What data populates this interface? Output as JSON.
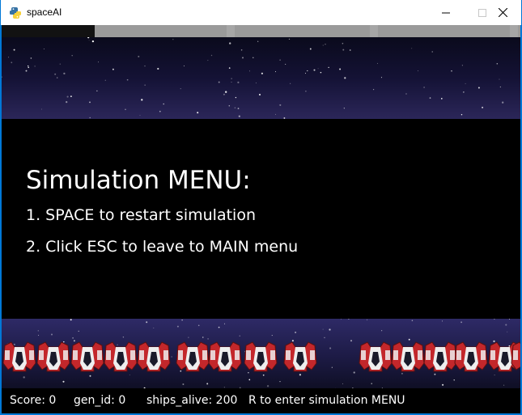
{
  "window": {
    "title": "spaceAI",
    "icon": "python-icon",
    "controls": [
      "minimize-icon",
      "maximize-icon",
      "close-icon"
    ]
  },
  "colors": {
    "titlebar_border": "#0078d7",
    "background": "#0b0b1e",
    "menu_panel": "#000000",
    "text": "#ffffff",
    "ship_red": "#c3272b",
    "ship_white": "#eeeeee"
  },
  "progress": {
    "fraction": 0.18
  },
  "menu": {
    "title": "Simulation MENU:",
    "items": [
      "1. SPACE to restart simulation",
      "2. Click ESC to leave to MAIN menu"
    ]
  },
  "fleet": {
    "icon": "spaceship-icon",
    "visible_ships": 15
  },
  "status": {
    "score": "Score: 0",
    "gen_id": "gen_id: 0",
    "ships_alive": "ships_alive: 200",
    "hint": "R to enter simulation MENU"
  }
}
